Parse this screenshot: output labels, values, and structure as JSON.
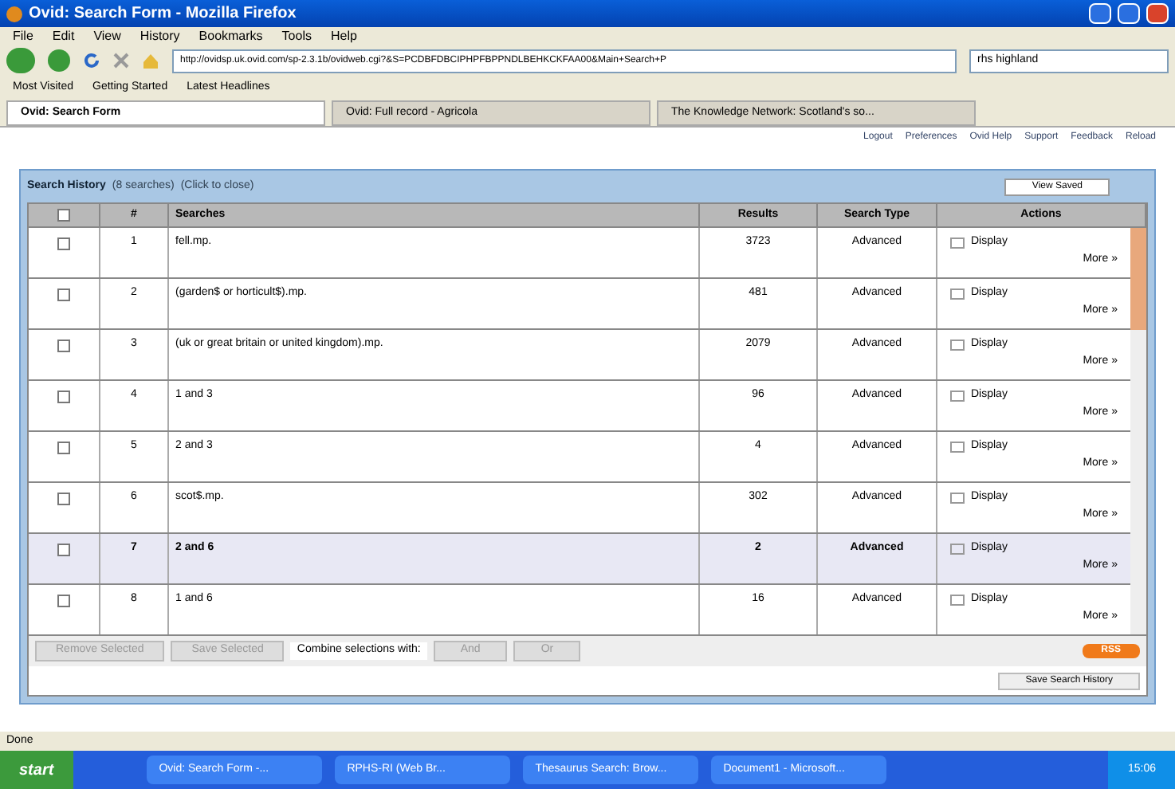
{
  "window": {
    "title": "Ovid: Search Form - Mozilla Firefox"
  },
  "menu": [
    "File",
    "Edit",
    "View",
    "History",
    "Bookmarks",
    "Tools",
    "Help"
  ],
  "address": {
    "value": "http://ovidsp.uk.ovid.com/sp-2.3.1b/ovidweb.cgi?&S=PCDBFDBCIPHPFBPPNDLBEHKCKFAA00&Main+Search+P"
  },
  "search": {
    "value": "rhs highland"
  },
  "bookmarks": [
    "Most Visited",
    "Getting Started",
    "Latest Headlines"
  ],
  "tabs": [
    {
      "label": "Ovid: Search Form",
      "selected": true
    },
    {
      "label": "Ovid: Full record - Agricola",
      "selected": false
    },
    {
      "label": "The Knowledge Network: Scotland's so...",
      "selected": false
    }
  ],
  "top_links": [
    "Logout",
    "Preferences",
    "Ovid Help",
    "Support",
    "Feedback",
    "Reload"
  ],
  "history": {
    "title": "Search History",
    "count": "(8 searches)",
    "toggle": "(Click to close)",
    "view_saved": "View Saved",
    "select_all_checked": false,
    "columns": [
      "#",
      "Searches",
      "Results",
      "Search Type",
      "Actions"
    ],
    "rows": [
      {
        "num": "1",
        "query": "fell.mp.",
        "results": "3723",
        "type": "Advanced",
        "display": "Display",
        "more": "More »",
        "checked": false,
        "selected": false
      },
      {
        "num": "2",
        "query": "(garden$ or horticult$).mp.",
        "results": "481",
        "type": "Advanced",
        "display": "Display",
        "more": "More »",
        "checked": false,
        "selected": false
      },
      {
        "num": "3",
        "query": "(uk or great britain or united kingdom).mp.",
        "results": "2079",
        "type": "Advanced",
        "display": "Display",
        "more": "More »",
        "checked": false,
        "selected": false
      },
      {
        "num": "4",
        "query": "1 and 3",
        "results": "96",
        "type": "Advanced",
        "display": "Display",
        "more": "More »",
        "checked": false,
        "selected": false
      },
      {
        "num": "5",
        "query": "2 and 3",
        "results": "4",
        "type": "Advanced",
        "display": "Display",
        "more": "More »",
        "checked": false,
        "selected": false
      },
      {
        "num": "6",
        "query": "scot$.mp.",
        "results": "302",
        "type": "Advanced",
        "display": "Display",
        "more": "More »",
        "checked": false,
        "selected": false
      },
      {
        "num": "7",
        "query": "2 and 6",
        "results": "2",
        "type": "Advanced",
        "display": "Display",
        "more": "More »",
        "checked": false,
        "selected": true
      },
      {
        "num": "8",
        "query": "1 and 6",
        "results": "16",
        "type": "Advanced",
        "display": "Display",
        "more": "More »",
        "checked": false,
        "selected": false
      }
    ],
    "buttons": [
      "Remove Selected",
      "Save Selected"
    ],
    "combine_label": "Combine selections with:",
    "combine": [
      "And",
      "Or"
    ],
    "rss": "RSS",
    "save_history": "Save Search History"
  },
  "status_bar": "Done",
  "taskbar": {
    "start": "start",
    "items": [
      "Ovid: Search Form -...",
      "RPHS-RI (Web Br...",
      "Thesaurus Search: Brow...",
      "Document1 - Microsoft..."
    ],
    "clock": "15:06"
  }
}
